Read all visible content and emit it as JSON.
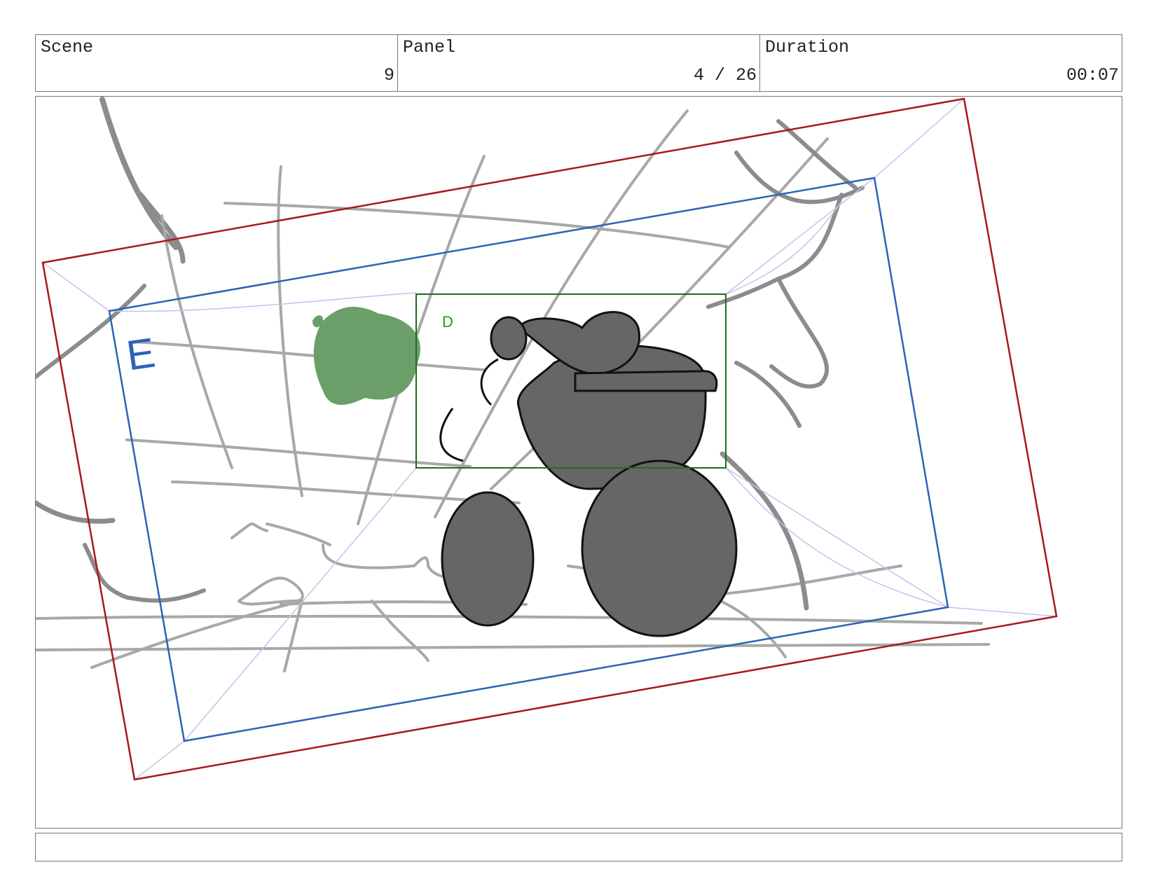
{
  "header": {
    "scene": {
      "label": "Scene",
      "value": "9"
    },
    "panel": {
      "label": "Panel",
      "value": "4 / 26"
    },
    "duration": {
      "label": "Duration",
      "value": "00:07"
    }
  },
  "frame": {
    "camera_tags": {
      "outer": "E",
      "inner": "D"
    },
    "colors": {
      "outer_frame": "#a8171b",
      "mid_frame": "#2d63b4",
      "inner_frame": "#1c6e1c",
      "guides": "#c4c2ec",
      "sketch": "#a8a8a8",
      "figure_fill": "#666666",
      "blob": "#6a9f6a"
    }
  },
  "notes": {
    "text": ""
  }
}
